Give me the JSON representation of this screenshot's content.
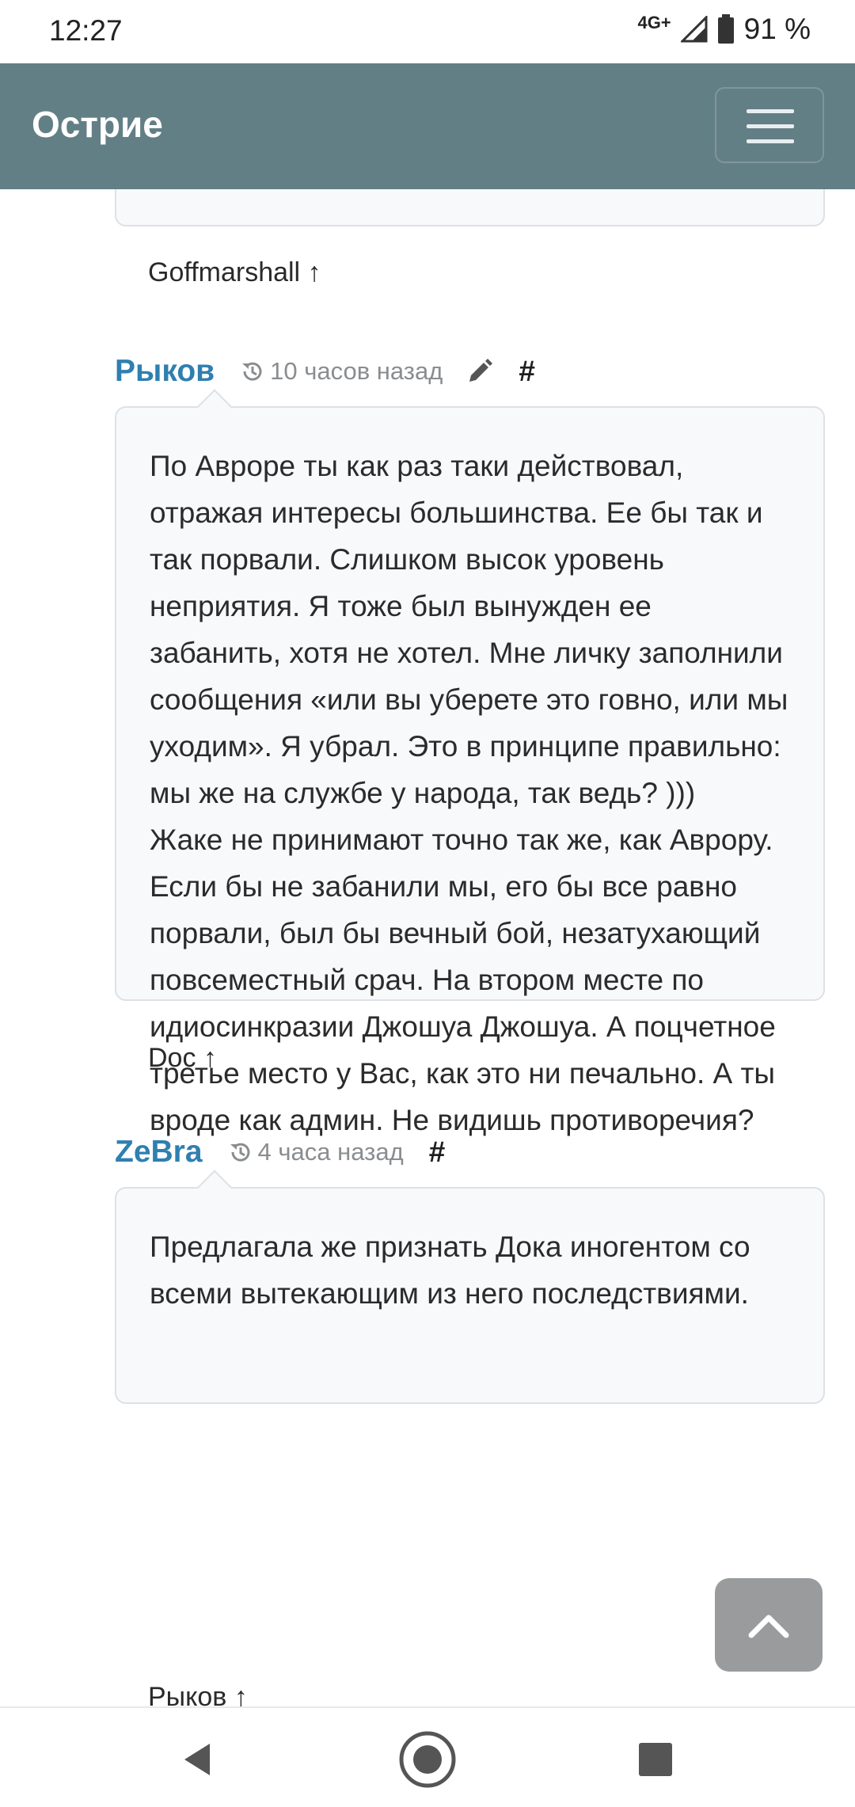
{
  "status_bar": {
    "time": "12:27",
    "network": "4G+",
    "battery": "91 %"
  },
  "navbar": {
    "brand": "Острие",
    "bg_color": "#637f86"
  },
  "thread": {
    "previous_reply": "Goffmarshall ↑",
    "comments": [
      {
        "author": "Рыков",
        "time": "10 часов назад",
        "hash": "#",
        "text": "По Авроре ты как раз таки действовал, отражая интересы большинства. Ее бы так и так порвали. Слишком высок уровень неприятия. Я тоже был вынужден ее забанить, хотя не хотел. Мне личку заполнили сообщения «или вы уберете это говно, или мы уходим». Я убрал. Это в принципе правильно: мы же на службе у народа, так ведь? )))\nЖаке не принимают точно так же, как Аврору. Если бы не забанили мы, его бы все равно порвали, был бы вечный бой, незатухающий повсеместный срач. На втором месте по идиосинкразии Джошуа Джошуа. А поцчетное третье место у Вас, как это ни печально. А ты вроде как админ. Не видишь противоречия?",
        "reply_link": "Doc ↑"
      },
      {
        "author": "ZeBra",
        "time": "4 часа назад",
        "hash": "#",
        "text": "Предлагала же признать Дока иногентом со всеми вытекающим из него последствиями.",
        "reply_link": "Рыков ↑"
      }
    ]
  },
  "colors": {
    "author": "#2f7fb0",
    "scroll_top_button": "#999b9c"
  },
  "icons": {
    "menu": "hamburger-icon",
    "history": "history-icon",
    "edit": "pencil-icon",
    "scroll_top": "chevron-up-icon",
    "back": "back-triangle-icon",
    "home": "home-circle-icon",
    "recents": "recents-square-icon"
  }
}
